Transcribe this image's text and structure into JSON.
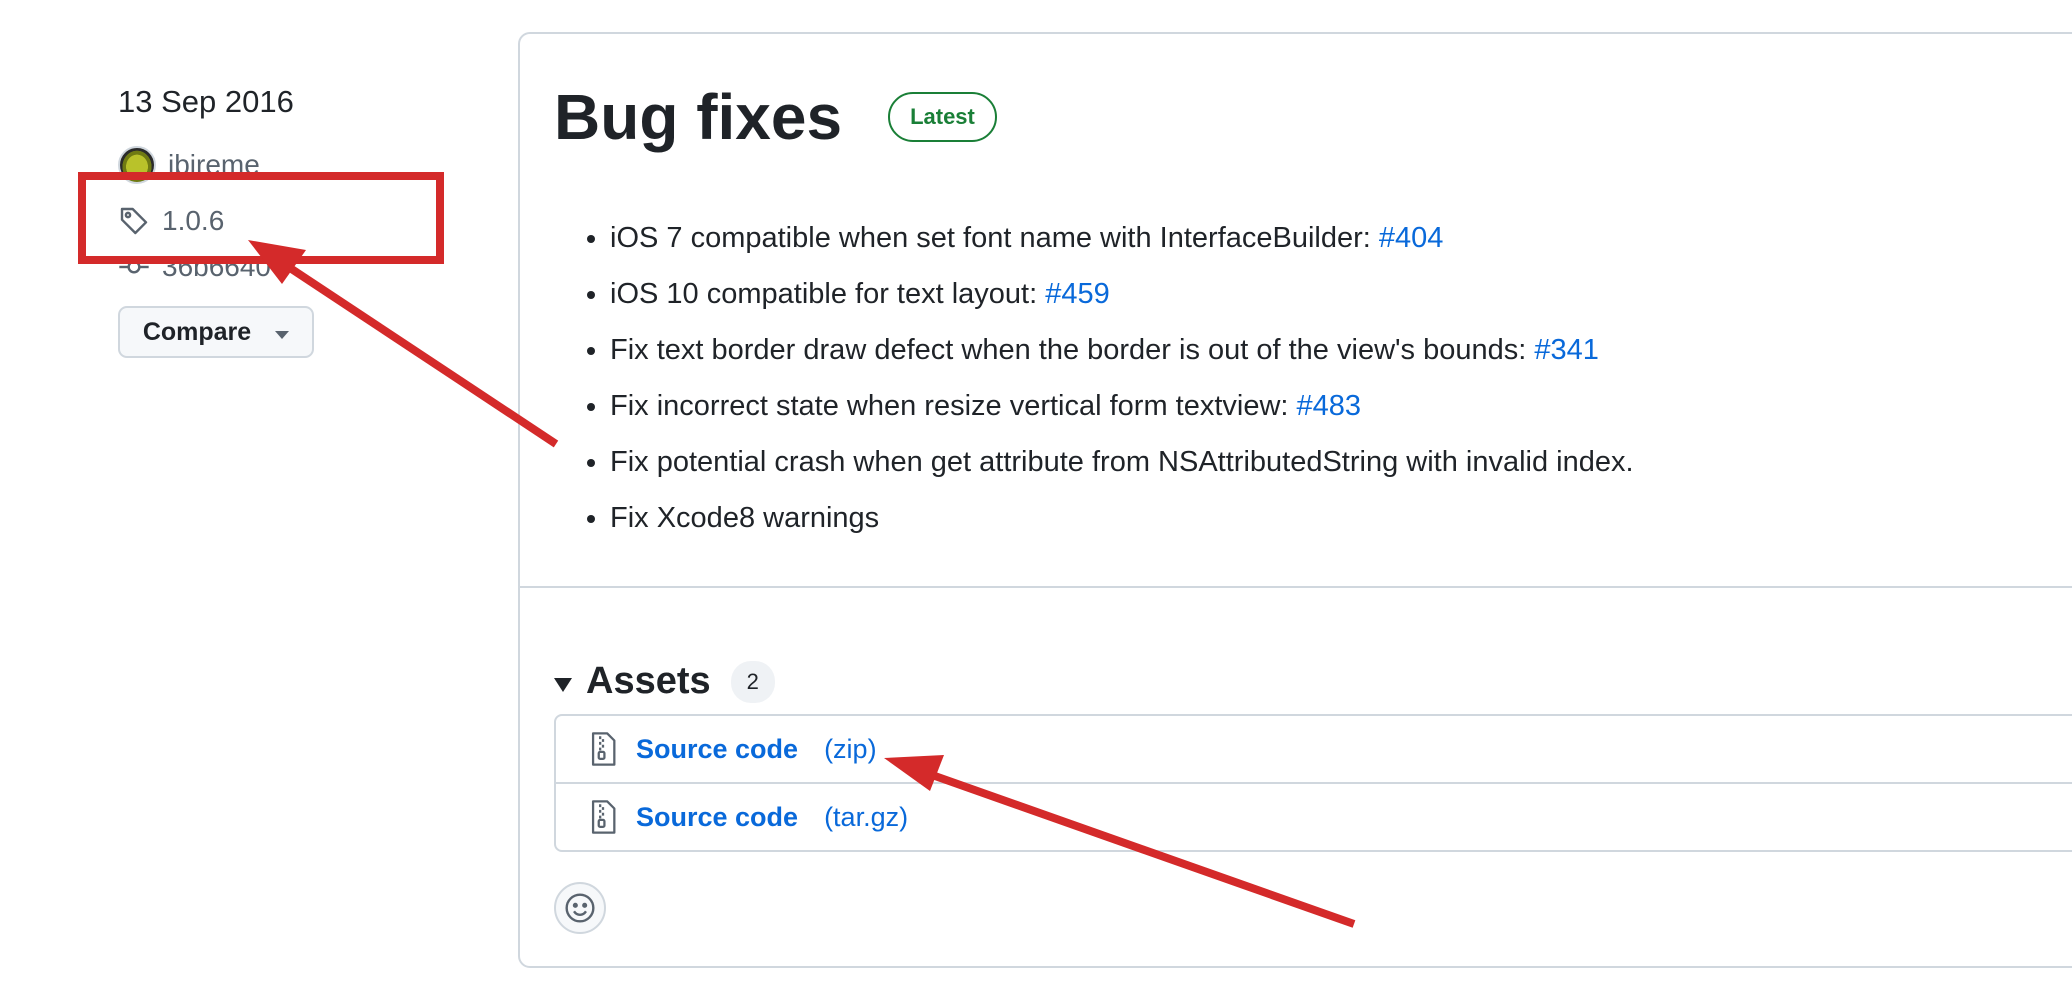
{
  "sidebar": {
    "date": "13 Sep 2016",
    "author": "ibireme",
    "tag": "1.0.6",
    "commit": "36b6640",
    "compare_label": "Compare"
  },
  "release": {
    "title": "Bug fixes",
    "badge": "Latest",
    "notes": [
      {
        "text": "iOS 7 compatible when set font name with InterfaceBuilder: ",
        "link": "#404"
      },
      {
        "text": "iOS 10 compatible for text layout: ",
        "link": "#459"
      },
      {
        "text": "Fix text border draw defect when the border is out of the view's bounds: ",
        "link": "#341"
      },
      {
        "text": "Fix incorrect state when resize vertical form textview: ",
        "link": "#483"
      },
      {
        "text": "Fix potential crash when get attribute from NSAttributedString with invalid index.",
        "link": ""
      },
      {
        "text": "Fix Xcode8 warnings",
        "link": ""
      }
    ]
  },
  "assets": {
    "title": "Assets",
    "count": "2",
    "items": [
      {
        "name": "Source code",
        "ext": "(zip)"
      },
      {
        "name": "Source code",
        "ext": "(tar.gz)"
      }
    ]
  },
  "colors": {
    "link": "#0969da",
    "latest_badge": "#1a7f37",
    "annotation": "#d42a2a"
  },
  "icons": [
    "tag-icon",
    "commit-icon",
    "zip-file-icon",
    "smiley-icon",
    "chevron-down-icon"
  ]
}
